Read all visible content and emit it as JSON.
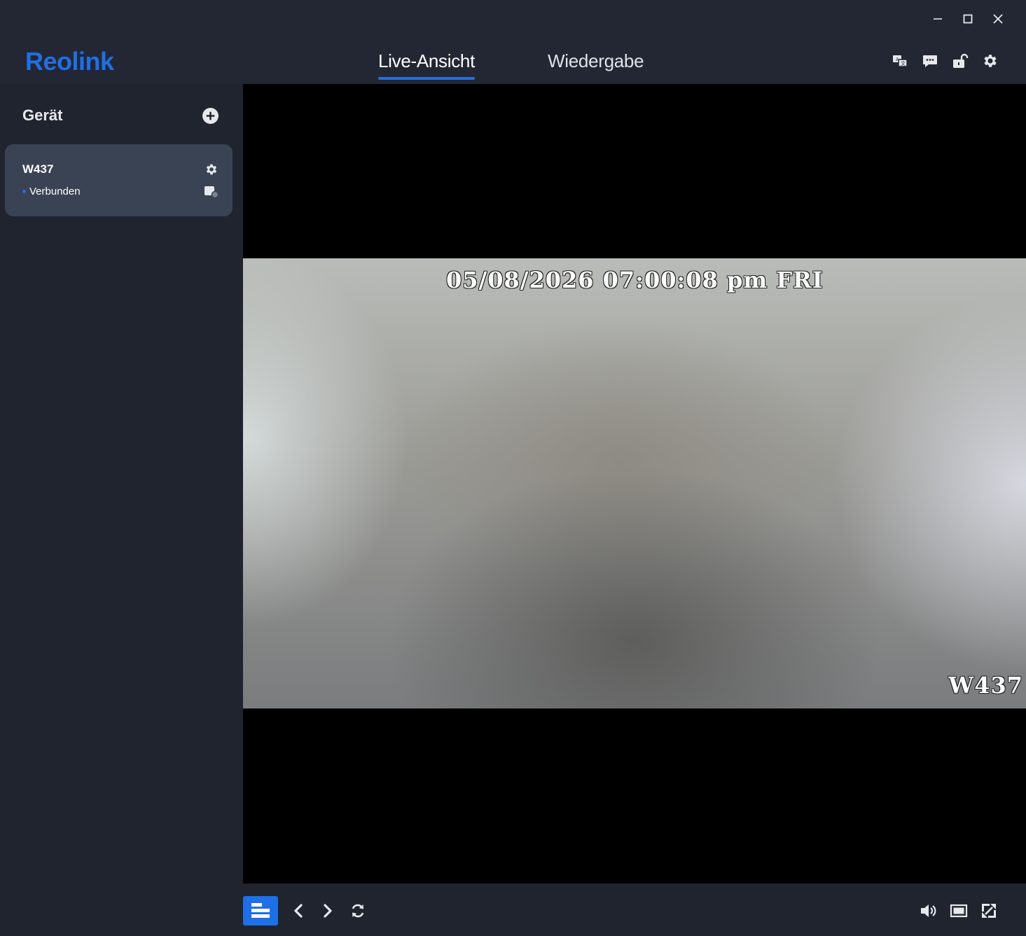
{
  "app": {
    "logo_text": "Reolink",
    "brand_color": "#1f6fe6"
  },
  "window_controls": {
    "minimize_icon": "minimize-icon",
    "maximize_icon": "maximize-icon",
    "close_icon": "close-icon"
  },
  "header": {
    "tabs": [
      {
        "label": "Live-Ansicht",
        "active": true
      },
      {
        "label": "Wiedergabe",
        "active": false
      }
    ],
    "icons": [
      "translate-icon",
      "chat-icon",
      "unlock-icon",
      "gear-icon"
    ]
  },
  "sidebar": {
    "title": "Gerät",
    "devices": [
      {
        "name": "W437",
        "status": "Verbunden",
        "status_color": "#1f6fe6"
      }
    ]
  },
  "video": {
    "osd_datetime": "05/08/2026 07:00:08 pm FRI",
    "osd_camera_name": "W437"
  },
  "toolbar": {
    "left_icons": [
      "layout-icon",
      "chevron-left-icon",
      "chevron-right-icon",
      "refresh-icon"
    ],
    "right_icons": [
      "volume-icon",
      "aspect-ratio-icon",
      "fullscreen-icon"
    ]
  }
}
